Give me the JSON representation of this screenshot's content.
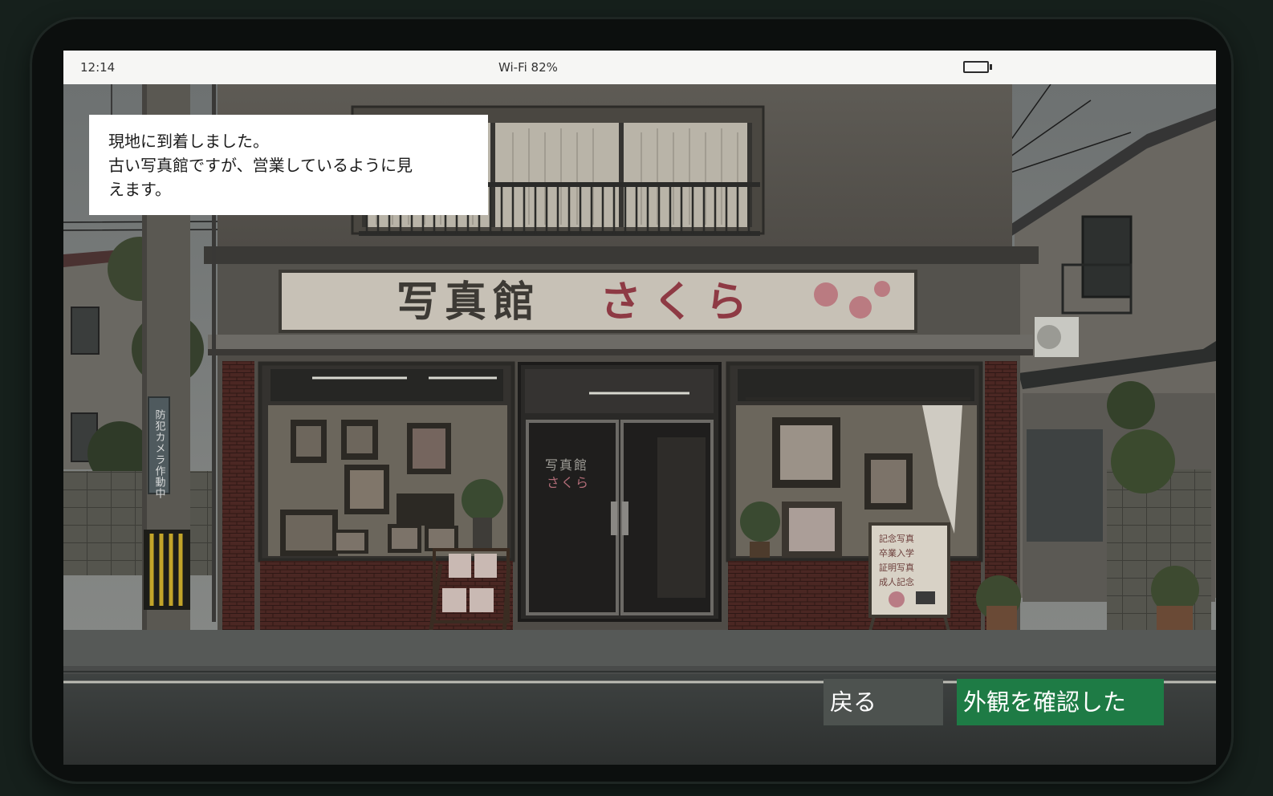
{
  "status_bar": {
    "time": "12:14",
    "network": "Wi-Fi  82%"
  },
  "message": {
    "lines": [
      "現地に到着しました。",
      "古い写真館ですが、営業しているように見",
      "えます。"
    ]
  },
  "scene": {
    "shop_sign_name": "写真館",
    "shop_sign_kana": "さくら",
    "door_text_1": "写真館",
    "door_text_2": "さくら",
    "pole_sign": "防犯カメラ作動中",
    "board_text": [
      "記念写真",
      "卒業入学",
      "証明写真",
      "成人記念"
    ]
  },
  "buttons": {
    "back": "戻る",
    "confirm": "外観を確認した"
  },
  "colors": {
    "confirm_button": "#1e7b45",
    "back_button": "#4d524f",
    "sign_kana": "#8e3a44"
  }
}
